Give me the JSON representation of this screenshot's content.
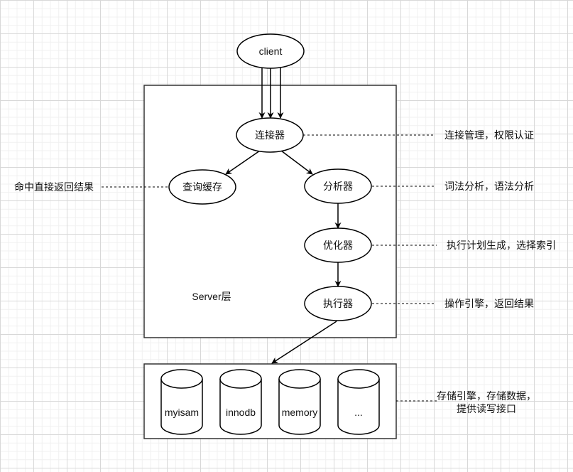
{
  "nodes": {
    "client": "client",
    "connector": "连接器",
    "query_cache": "查询缓存",
    "analyzer": "分析器",
    "optimizer": "优化器",
    "executor": "执行器"
  },
  "server_layer_label": "Server层",
  "storage_engines": [
    "myisam",
    "innodb",
    "memory",
    "..."
  ],
  "annotations": {
    "connector": "连接管理，权限认证",
    "query_cache": "命中直接返回结果",
    "analyzer": "词法分析，语法分析",
    "optimizer": "执行计划生成，选择索引",
    "executor": "操作引擎，返回结果",
    "storage_line1": "存储引擎，存储数据，",
    "storage_line2": "提供读写接口"
  },
  "colors": {
    "stroke": "#000000",
    "fill": "#ffffff",
    "grid_major": "#d8d8d8",
    "grid_minor": "#f0f0f0"
  }
}
